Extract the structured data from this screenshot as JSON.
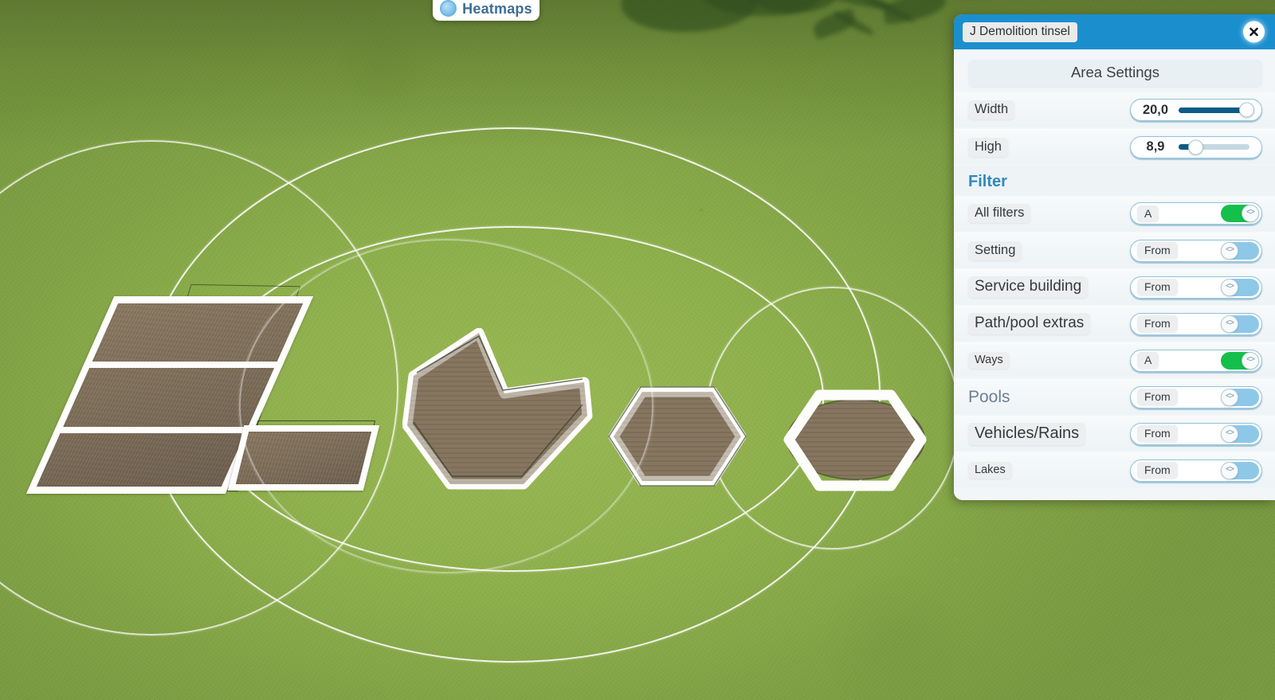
{
  "toolbar": {
    "heatmaps": {
      "label": "Heatmaps",
      "icon": "circle-dot-icon"
    }
  },
  "panel": {
    "title": "J Demolition tinsel",
    "close_icon": "close-icon",
    "area_settings": {
      "header": "Area Settings",
      "sliders": [
        {
          "label": "Width",
          "value": "20,0",
          "percent": 96
        },
        {
          "label": "High",
          "value": "8,9",
          "percent": 24
        }
      ]
    },
    "filter": {
      "header": "Filter",
      "rows": [
        {
          "label": "All filters",
          "state": "A",
          "on": true,
          "label_size": "lbl-m",
          "pill": true
        },
        {
          "label": "Setting",
          "state": "From",
          "on": false,
          "label_size": "lbl-m",
          "pill": true
        },
        {
          "label": "Service building",
          "state": "From",
          "on": false,
          "label_size": "lbl-l",
          "pill": true
        },
        {
          "label": "Path/pool extras",
          "state": "From",
          "on": false,
          "label_size": "lbl-l",
          "pill": true
        },
        {
          "label": "Ways",
          "state": "A",
          "on": true,
          "label_size": "lbl-s",
          "pill": true
        },
        {
          "label": "Pools",
          "state": "From",
          "on": false,
          "label_size": "lbl-blue",
          "pill": false
        },
        {
          "label": "Vehicles/Rains",
          "state": "From",
          "on": false,
          "label_size": "lbl-xl",
          "pill": true
        },
        {
          "label": "Lakes",
          "state": "From",
          "on": false,
          "label_size": "lbl-s",
          "pill": true
        }
      ]
    }
  },
  "colors": {
    "title_bar": "#1b8fce",
    "filter_header": "#2f89bd",
    "toggle_on": "#14c04b",
    "toggle_off": "#8ec8e8",
    "slider_fill": "#0c5c86",
    "panel_bg": "#f2f6f8",
    "grass": "#9cbb55",
    "plot_dirt": "#82725c",
    "plot_outline": "#fdfdfb"
  },
  "scene": {
    "description": "Isometric park-builder terrain with dirt construction plots and white circular area guides"
  }
}
